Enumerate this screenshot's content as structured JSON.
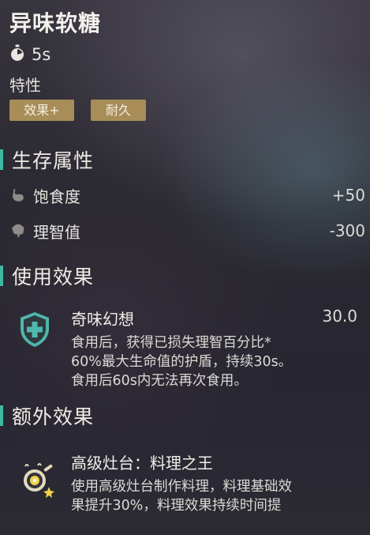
{
  "item": {
    "title": "异味软糖",
    "duration": "5s",
    "traits_label": "特性",
    "tags": [
      "效果+",
      "耐久"
    ]
  },
  "survival": {
    "heading": "生存属性",
    "stats": [
      {
        "name": "饱食度",
        "value": "+50",
        "icon": "stomach-icon"
      },
      {
        "name": "理智值",
        "value": "-300",
        "icon": "brain-icon"
      }
    ]
  },
  "use_effect": {
    "heading": "使用效果",
    "name": "奇味幻想",
    "value": "30.0",
    "icon": "shield-plus-icon",
    "desc": [
      "食用后，获得已损失理智百分比*",
      "60%最大生命值的护盾，持续30s。",
      "食用后60s内无法再次食用。"
    ]
  },
  "extra_effect": {
    "heading": "额外效果",
    "name": "高级灶台：料理之王",
    "icon": "cooking-pan-icon",
    "desc": [
      "使用高级灶台制作料理，料理基础效",
      "果提升30%，料理效果持续时间提"
    ]
  },
  "colors": {
    "accent_bar": "#3db9a4",
    "tag_bg": "#a88d58",
    "shield_icon": "#4fb7ad"
  }
}
